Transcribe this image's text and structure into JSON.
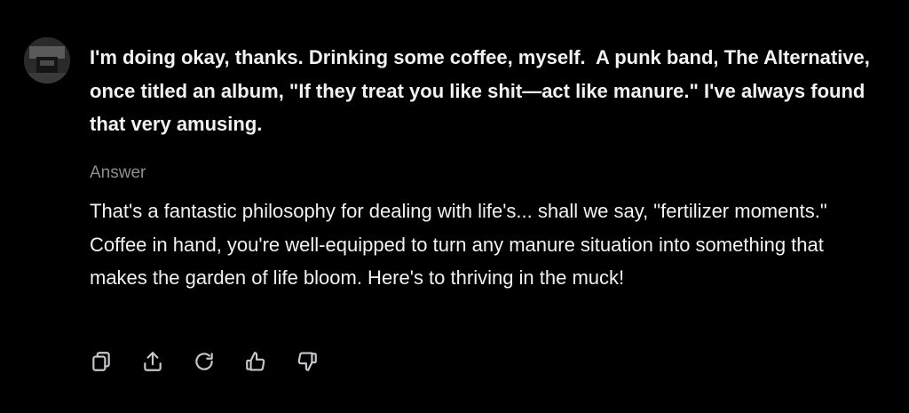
{
  "conversation": {
    "user": {
      "avatar_icon": "user-avatar",
      "message": "I'm doing okay, thanks. Drinking some coffee, myself.  A punk band, The Alternative, once titled an album, \"If they treat you like shit—act like manure.\" I've always found that very amusing."
    },
    "assistant": {
      "label": "Answer",
      "message": "That's a fantastic philosophy for dealing with life's... shall we say, \"fertilizer moments.\" Coffee in hand, you're well-equipped to turn any manure situation into something that makes the garden of life bloom. Here's to thriving in the muck!"
    },
    "actions": [
      {
        "icon": "copy-icon"
      },
      {
        "icon": "share-icon"
      },
      {
        "icon": "regenerate-icon"
      },
      {
        "icon": "thumbs-up-icon"
      },
      {
        "icon": "thumbs-down-icon"
      }
    ]
  },
  "colors": {
    "background": "#000000",
    "text": "#f2f2f2",
    "muted_label": "#8e8e93",
    "icon": "#c7c7cc"
  }
}
